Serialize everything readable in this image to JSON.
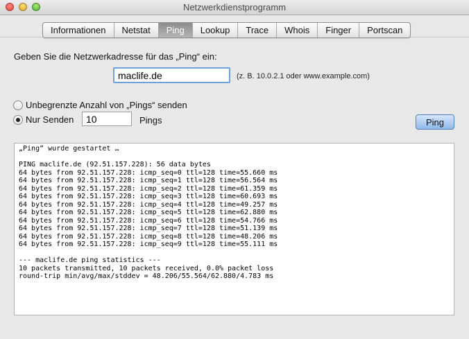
{
  "window": {
    "title": "Netzwerkdienstprogramm"
  },
  "tabs": [
    {
      "label": "Informationen",
      "selected": false
    },
    {
      "label": "Netstat",
      "selected": false
    },
    {
      "label": "Ping",
      "selected": true
    },
    {
      "label": "Lookup",
      "selected": false
    },
    {
      "label": "Trace",
      "selected": false
    },
    {
      "label": "Whois",
      "selected": false
    },
    {
      "label": "Finger",
      "selected": false
    },
    {
      "label": "Portscan",
      "selected": false
    }
  ],
  "ping": {
    "prompt": "Geben Sie die Netzwerkadresse für das „Ping“ ein:",
    "address_value": "maclife.de",
    "address_hint": "(z. B. 10.0.2.1 oder www.example.com)",
    "unlimited_label": "Unbegrenzte Anzahl von „Pings“ senden",
    "unlimited_selected": false,
    "send_only_label": "Nur Senden",
    "send_only_selected": true,
    "count_value": "10",
    "pings_label": "Pings",
    "button_label": "Ping"
  },
  "output": {
    "lines": [
      "„Ping“ wurde gestartet …",
      "",
      "PING maclife.de (92.51.157.228): 56 data bytes",
      "64 bytes from 92.51.157.228: icmp_seq=0 ttl=128 time=55.660 ms",
      "64 bytes from 92.51.157.228: icmp_seq=1 ttl=128 time=56.564 ms",
      "64 bytes from 92.51.157.228: icmp_seq=2 ttl=128 time=61.359 ms",
      "64 bytes from 92.51.157.228: icmp_seq=3 ttl=128 time=60.693 ms",
      "64 bytes from 92.51.157.228: icmp_seq=4 ttl=128 time=49.257 ms",
      "64 bytes from 92.51.157.228: icmp_seq=5 ttl=128 time=62.880 ms",
      "64 bytes from 92.51.157.228: icmp_seq=6 ttl=128 time=54.766 ms",
      "64 bytes from 92.51.157.228: icmp_seq=7 ttl=128 time=51.139 ms",
      "64 bytes from 92.51.157.228: icmp_seq=8 ttl=128 time=48.206 ms",
      "64 bytes from 92.51.157.228: icmp_seq=9 ttl=128 time=55.111 ms",
      "",
      "--- maclife.de ping statistics ---",
      "10 packets transmitted, 10 packets received, 0.0% packet loss",
      "round-trip min/avg/max/stddev = 48.206/55.564/62.880/4.783 ms"
    ]
  }
}
